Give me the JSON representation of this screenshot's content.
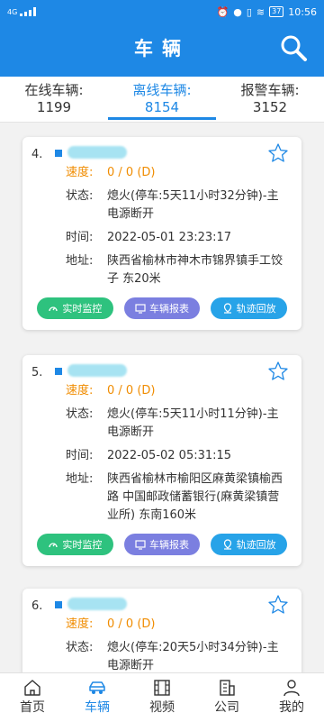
{
  "status_bar": {
    "network": "4G",
    "battery": "37",
    "time": "10:56"
  },
  "header": {
    "title": "车辆"
  },
  "tabs": [
    {
      "label": "在线车辆:",
      "count": "1199"
    },
    {
      "label": "离线车辆:",
      "count": "8154"
    },
    {
      "label": "报警车辆:",
      "count": "3152"
    }
  ],
  "field_labels": {
    "speed": "速度:",
    "status": "状态:",
    "time": "时间:",
    "address": "地址:"
  },
  "actions": {
    "monitor": "实时监控",
    "report": "车辆报表",
    "playback": "轨迹回放"
  },
  "vehicles": [
    {
      "index": "4.",
      "speed": "0 / 0 (D)",
      "status": "熄火(停车:5天11小时32分钟)-主电源断开",
      "time": "2022-05-01 23:23:17",
      "address": "陕西省榆林市神木市锦界镇手工饺子 东20米"
    },
    {
      "index": "5.",
      "speed": "0 / 0 (D)",
      "status": "熄火(停车:5天11小时11分钟)-主电源断开",
      "time": "2022-05-02 05:31:15",
      "address": "陕西省榆林市榆阳区麻黄梁镇榆西路 中国邮政储蓄银行(麻黄梁镇营业所) 东南160米"
    },
    {
      "index": "6.",
      "speed": "0 / 0 (D)",
      "status": "熄火(停车:20天5小时34分钟)-主电源断开"
    }
  ],
  "bottom_nav": [
    {
      "label": "首页",
      "icon": "home-icon"
    },
    {
      "label": "车辆",
      "icon": "car-icon"
    },
    {
      "label": "视频",
      "icon": "film-icon"
    },
    {
      "label": "公司",
      "icon": "building-icon"
    },
    {
      "label": "我的",
      "icon": "person-icon"
    }
  ],
  "colors": {
    "primary": "#1e88e5",
    "speed": "#f08c00",
    "green": "#2ec27e",
    "purple": "#7b7fe0",
    "blue": "#27a3e8"
  }
}
